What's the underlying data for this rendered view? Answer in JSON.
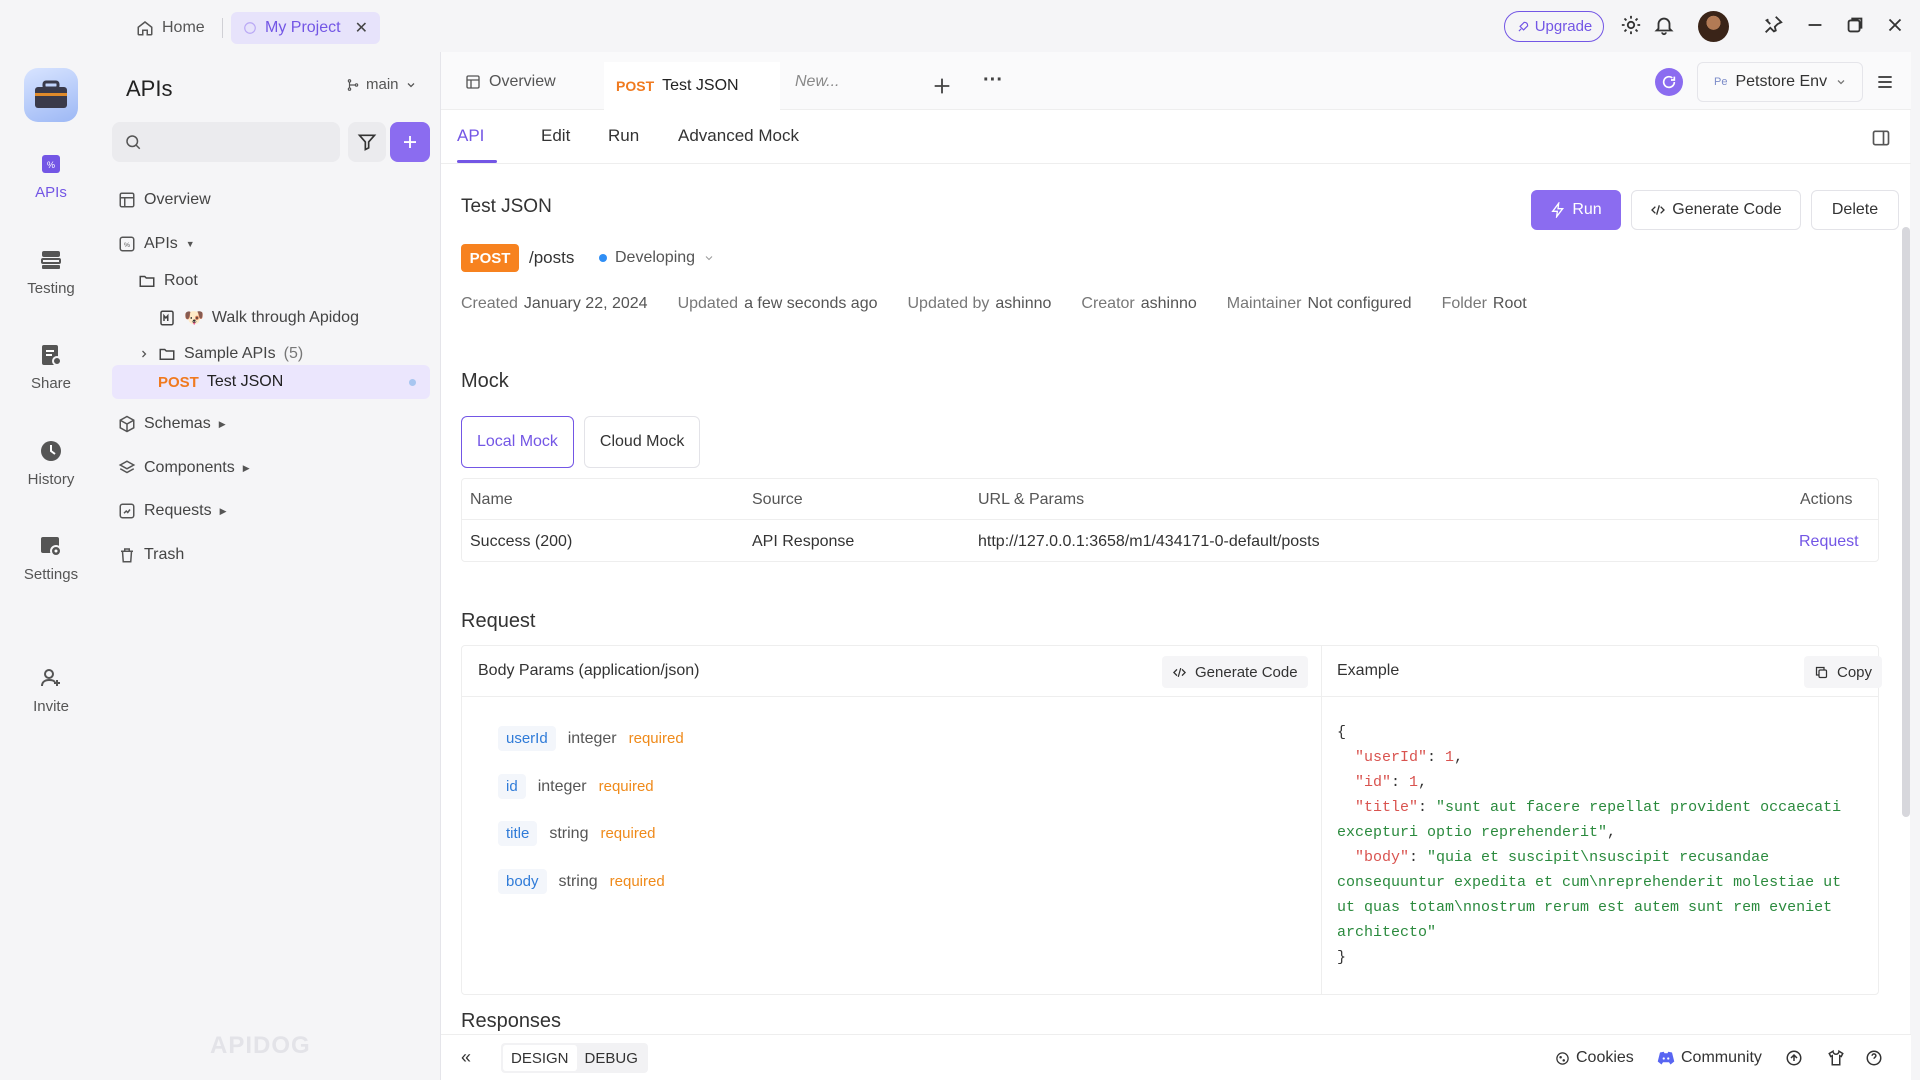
{
  "titlebar": {
    "home_label": "Home",
    "project_label": "My Project",
    "close_glyph": "✕",
    "upgrade_label": "Upgrade",
    "icons": [
      "home-icon",
      "project-icon",
      "close-icon",
      "rocket-icon",
      "gear-icon",
      "bell-icon",
      "avatar",
      "pin-icon",
      "minimize-icon",
      "restore-icon",
      "close-window-icon"
    ]
  },
  "rail": {
    "items": [
      {
        "label": "APIs",
        "icon": "apis-icon",
        "active": true
      },
      {
        "label": "Testing",
        "icon": "testing-icon"
      },
      {
        "label": "Share",
        "icon": "share-icon"
      },
      {
        "label": "History",
        "icon": "history-icon"
      },
      {
        "label": "Settings",
        "icon": "settings-icon"
      },
      {
        "label": "Invite",
        "icon": "invite-icon"
      }
    ]
  },
  "sidebar": {
    "title": "APIs",
    "branch": "main",
    "tree": {
      "overview": "Overview",
      "apis": "APIs",
      "root": "Root",
      "walk": "Walk through Apidog",
      "walk_emoji": "🐶",
      "sample": "Sample APIs",
      "sample_count": "(5)",
      "test_method": "POST",
      "test_name": "Test JSON",
      "schemas": "Schemas",
      "components": "Components",
      "requests": "Requests",
      "trash": "Trash"
    },
    "brand": "APIDOG"
  },
  "doc_tabs": {
    "overview": "Overview",
    "test_method": "POST",
    "test_name": "Test JSON",
    "new_tab": "New...",
    "more": "···",
    "env": "Petstore Env",
    "env_abbr": "Pe"
  },
  "sub_tabs": [
    "API",
    "Edit",
    "Run",
    "Advanced Mock"
  ],
  "api": {
    "title": "Test JSON",
    "run_label": "Run",
    "generate_code_label": "Generate Code",
    "delete_label": "Delete",
    "method": "POST",
    "path": "/posts",
    "status": "Developing",
    "meta": [
      {
        "label": "Created",
        "value": "January 22, 2024"
      },
      {
        "label": "Updated",
        "value": "a few seconds ago"
      },
      {
        "label": "Updated by",
        "value": "ashinno"
      },
      {
        "label": "Creator",
        "value": "ashinno"
      },
      {
        "label": "Maintainer",
        "value": "Not configured"
      },
      {
        "label": "Folder",
        "value": "Root"
      }
    ]
  },
  "mock": {
    "title": "Mock",
    "tabs": [
      "Local Mock",
      "Cloud Mock"
    ],
    "columns": [
      "Name",
      "Source",
      "URL & Params",
      "Actions"
    ],
    "rows": [
      {
        "name": "Success (200)",
        "source": "API Response",
        "url": "http://127.0.0.1:3658/m1/434171-0-default/posts",
        "action": "Request"
      }
    ]
  },
  "request": {
    "title": "Request",
    "body_title": "Body Params (application/json)",
    "generate_code_label": "Generate Code",
    "example_title": "Example",
    "copy_label": "Copy",
    "params": [
      {
        "name": "userId",
        "type": "integer",
        "req": "required"
      },
      {
        "name": "id",
        "type": "integer",
        "req": "required"
      },
      {
        "name": "title",
        "type": "string",
        "req": "required"
      },
      {
        "name": "body",
        "type": "string",
        "req": "required"
      }
    ],
    "example": {
      "open": "{",
      "close": "}",
      "userId_key": "\"userId\"",
      "userId_val": "1",
      "id_key": "\"id\"",
      "id_val": "1",
      "title_key": "\"title\"",
      "title_val": "\"sunt aut facere repellat provident occaecati excepturi optio reprehenderit\"",
      "body_key": "\"body\"",
      "body_val": "\"quia et suscipit\\nsuscipit recusandae consequuntur expedita et cum\\nreprehenderit molestiae ut ut quas totam\\nnostrum rerum est autem sunt rem eveniet architecto\""
    }
  },
  "responses_title": "Responses",
  "bottombar": {
    "collapse": "«",
    "design": "DESIGN",
    "debug": "DEBUG",
    "cookies": "Cookies",
    "community": "Community"
  },
  "colors": {
    "accent": "#7356e5",
    "post": "#f7821f",
    "required": "#ef8a1a"
  }
}
